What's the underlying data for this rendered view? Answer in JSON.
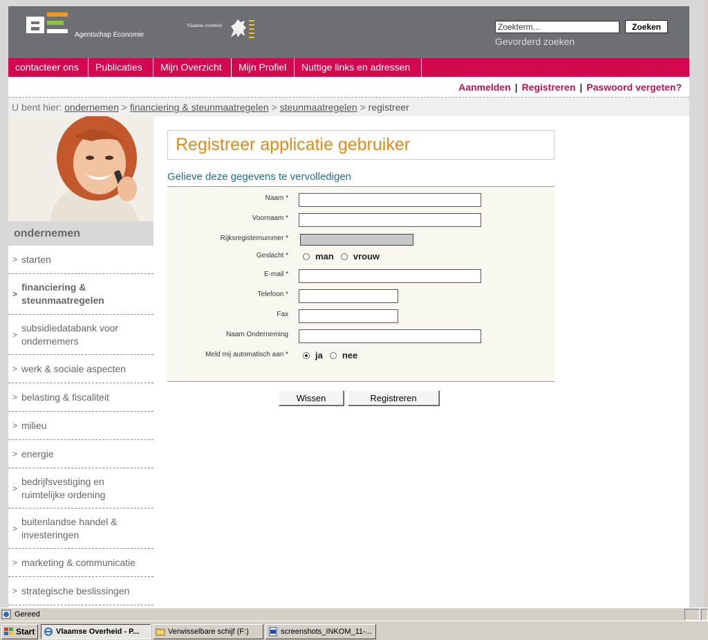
{
  "header": {
    "logo_text": "Agentschap Economie",
    "vo_text": "Vlaamse overheid",
    "search_placeholder": "Zoekterm...",
    "search_button": "Zoeken",
    "advanced_search": "Gevorderd zoeken"
  },
  "nav": {
    "items": [
      {
        "label": "contacteer ons"
      },
      {
        "label": "Publicaties"
      },
      {
        "label": "Mijn Overzicht"
      },
      {
        "label": "Mijn Profiel"
      },
      {
        "label": "Nuttige links en adressen"
      }
    ]
  },
  "auth": {
    "login": "Aanmelden",
    "register": "Registreren",
    "forgot": "Paswoord vergeten?",
    "separator": "|"
  },
  "breadcrumb": {
    "prefix": "U bent hier:",
    "items": [
      "ondernemen",
      "financiering & steunmaatregelen",
      "steunmaatregelen"
    ],
    "separator": ">",
    "current": "registreer"
  },
  "sidebar": {
    "section": "ondernemen",
    "arrow": ">",
    "items": [
      {
        "label": "starten"
      },
      {
        "label": "financiering & steunmaatregelen"
      },
      {
        "label": "subsidiedatabank voor ondernemers"
      },
      {
        "label": "werk & sociale aspecten"
      },
      {
        "label": "belasting & fiscaliteit"
      },
      {
        "label": "milieu"
      },
      {
        "label": "energie"
      },
      {
        "label": "bedrijfsvestiging en ruimtelijke ordening"
      },
      {
        "label": "buitenlandse handel & investeringen"
      },
      {
        "label": "marketing & communicatie"
      },
      {
        "label": "strategische beslissingen"
      }
    ]
  },
  "form": {
    "title": "Registreer applicatie gebruiker",
    "subtitle": "Gelieve deze gegevens te vervolledigen",
    "labels": {
      "naam": "Naam *",
      "voornaam": "Voornaam *",
      "rijksregister": "Rijksregisternummer *",
      "geslacht": "Geslacht *",
      "email": "E-mail *",
      "telefoon": "Telefoon *",
      "fax": "Fax",
      "onderneming": "Naam Onderneming",
      "automatisch": "Meld mij automatisch aan *"
    },
    "gender_options": [
      "man",
      "vrouw"
    ],
    "auto_options": [
      "ja",
      "nee"
    ],
    "auto_selected": "ja",
    "clear_button": "Wissen",
    "submit_button": "Registreren"
  },
  "statusbar": {
    "text": "Gereed"
  },
  "taskbar": {
    "start": "Start",
    "tasks": [
      {
        "label": "Vlaamse Overheid - P..."
      },
      {
        "label": "Verwisselbare schijf (F:)"
      },
      {
        "label": "screenshots_INKOM_11-..."
      }
    ]
  }
}
